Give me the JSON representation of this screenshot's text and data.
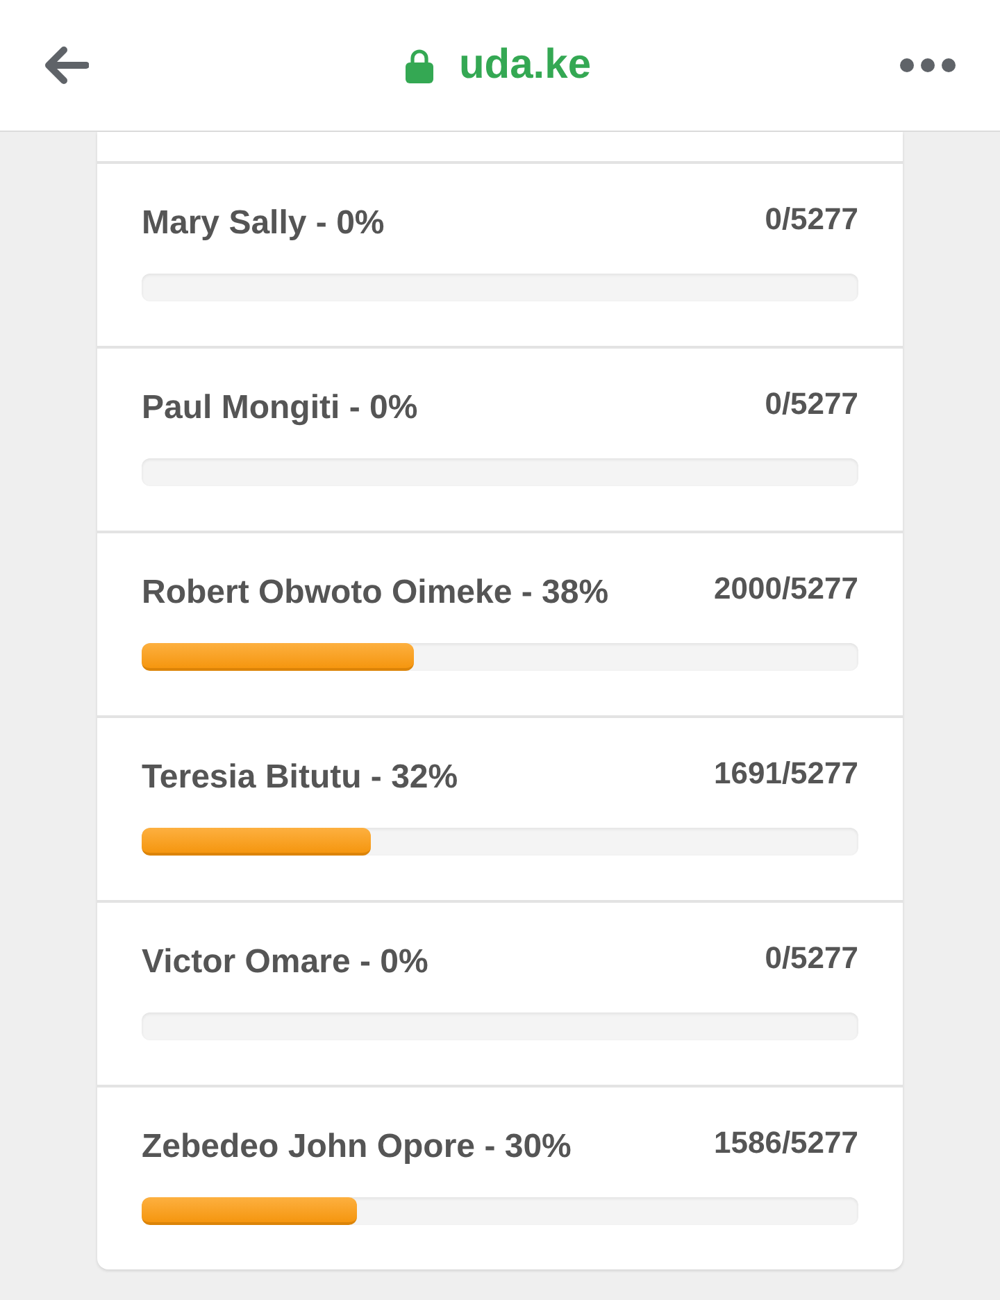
{
  "top_bar": {
    "url": "uda.ke"
  },
  "candidates": [
    {
      "label": "Mary Sally - 0%",
      "count": "0/5277"
    },
    {
      "label": "Paul Mongiti - 0%",
      "count": "0/5277"
    },
    {
      "label": "Robert Obwoto Oimeke - 38%",
      "count": "2000/5277",
      "level": 0.38
    },
    {
      "label": "Teresia Bitutu - 32%",
      "count": "1691/5277",
      "level": 0.32
    },
    {
      "label": "Victor Omare - 0%",
      "count": "0/5277"
    },
    {
      "label": "Zebedeo John Opore - 30%",
      "count": "1586/5277",
      "level": 0.3
    }
  ]
}
